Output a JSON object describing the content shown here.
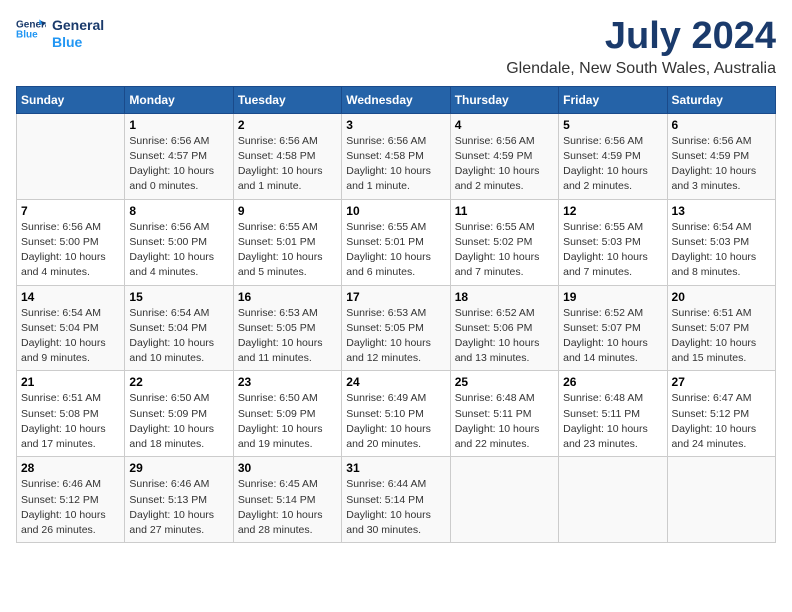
{
  "header": {
    "logo_text_general": "General",
    "logo_text_blue": "Blue",
    "month": "July 2024",
    "location": "Glendale, New South Wales, Australia"
  },
  "days_of_week": [
    "Sunday",
    "Monday",
    "Tuesday",
    "Wednesday",
    "Thursday",
    "Friday",
    "Saturday"
  ],
  "weeks": [
    [
      {
        "day": "",
        "info": ""
      },
      {
        "day": "1",
        "info": "Sunrise: 6:56 AM\nSunset: 4:57 PM\nDaylight: 10 hours\nand 0 minutes."
      },
      {
        "day": "2",
        "info": "Sunrise: 6:56 AM\nSunset: 4:58 PM\nDaylight: 10 hours\nand 1 minute."
      },
      {
        "day": "3",
        "info": "Sunrise: 6:56 AM\nSunset: 4:58 PM\nDaylight: 10 hours\nand 1 minute."
      },
      {
        "day": "4",
        "info": "Sunrise: 6:56 AM\nSunset: 4:59 PM\nDaylight: 10 hours\nand 2 minutes."
      },
      {
        "day": "5",
        "info": "Sunrise: 6:56 AM\nSunset: 4:59 PM\nDaylight: 10 hours\nand 2 minutes."
      },
      {
        "day": "6",
        "info": "Sunrise: 6:56 AM\nSunset: 4:59 PM\nDaylight: 10 hours\nand 3 minutes."
      }
    ],
    [
      {
        "day": "7",
        "info": "Sunrise: 6:56 AM\nSunset: 5:00 PM\nDaylight: 10 hours\nand 4 minutes."
      },
      {
        "day": "8",
        "info": "Sunrise: 6:56 AM\nSunset: 5:00 PM\nDaylight: 10 hours\nand 4 minutes."
      },
      {
        "day": "9",
        "info": "Sunrise: 6:55 AM\nSunset: 5:01 PM\nDaylight: 10 hours\nand 5 minutes."
      },
      {
        "day": "10",
        "info": "Sunrise: 6:55 AM\nSunset: 5:01 PM\nDaylight: 10 hours\nand 6 minutes."
      },
      {
        "day": "11",
        "info": "Sunrise: 6:55 AM\nSunset: 5:02 PM\nDaylight: 10 hours\nand 7 minutes."
      },
      {
        "day": "12",
        "info": "Sunrise: 6:55 AM\nSunset: 5:03 PM\nDaylight: 10 hours\nand 7 minutes."
      },
      {
        "day": "13",
        "info": "Sunrise: 6:54 AM\nSunset: 5:03 PM\nDaylight: 10 hours\nand 8 minutes."
      }
    ],
    [
      {
        "day": "14",
        "info": "Sunrise: 6:54 AM\nSunset: 5:04 PM\nDaylight: 10 hours\nand 9 minutes."
      },
      {
        "day": "15",
        "info": "Sunrise: 6:54 AM\nSunset: 5:04 PM\nDaylight: 10 hours\nand 10 minutes."
      },
      {
        "day": "16",
        "info": "Sunrise: 6:53 AM\nSunset: 5:05 PM\nDaylight: 10 hours\nand 11 minutes."
      },
      {
        "day": "17",
        "info": "Sunrise: 6:53 AM\nSunset: 5:05 PM\nDaylight: 10 hours\nand 12 minutes."
      },
      {
        "day": "18",
        "info": "Sunrise: 6:52 AM\nSunset: 5:06 PM\nDaylight: 10 hours\nand 13 minutes."
      },
      {
        "day": "19",
        "info": "Sunrise: 6:52 AM\nSunset: 5:07 PM\nDaylight: 10 hours\nand 14 minutes."
      },
      {
        "day": "20",
        "info": "Sunrise: 6:51 AM\nSunset: 5:07 PM\nDaylight: 10 hours\nand 15 minutes."
      }
    ],
    [
      {
        "day": "21",
        "info": "Sunrise: 6:51 AM\nSunset: 5:08 PM\nDaylight: 10 hours\nand 17 minutes."
      },
      {
        "day": "22",
        "info": "Sunrise: 6:50 AM\nSunset: 5:09 PM\nDaylight: 10 hours\nand 18 minutes."
      },
      {
        "day": "23",
        "info": "Sunrise: 6:50 AM\nSunset: 5:09 PM\nDaylight: 10 hours\nand 19 minutes."
      },
      {
        "day": "24",
        "info": "Sunrise: 6:49 AM\nSunset: 5:10 PM\nDaylight: 10 hours\nand 20 minutes."
      },
      {
        "day": "25",
        "info": "Sunrise: 6:48 AM\nSunset: 5:11 PM\nDaylight: 10 hours\nand 22 minutes."
      },
      {
        "day": "26",
        "info": "Sunrise: 6:48 AM\nSunset: 5:11 PM\nDaylight: 10 hours\nand 23 minutes."
      },
      {
        "day": "27",
        "info": "Sunrise: 6:47 AM\nSunset: 5:12 PM\nDaylight: 10 hours\nand 24 minutes."
      }
    ],
    [
      {
        "day": "28",
        "info": "Sunrise: 6:46 AM\nSunset: 5:12 PM\nDaylight: 10 hours\nand 26 minutes."
      },
      {
        "day": "29",
        "info": "Sunrise: 6:46 AM\nSunset: 5:13 PM\nDaylight: 10 hours\nand 27 minutes."
      },
      {
        "day": "30",
        "info": "Sunrise: 6:45 AM\nSunset: 5:14 PM\nDaylight: 10 hours\nand 28 minutes."
      },
      {
        "day": "31",
        "info": "Sunrise: 6:44 AM\nSunset: 5:14 PM\nDaylight: 10 hours\nand 30 minutes."
      },
      {
        "day": "",
        "info": ""
      },
      {
        "day": "",
        "info": ""
      },
      {
        "day": "",
        "info": ""
      }
    ]
  ]
}
